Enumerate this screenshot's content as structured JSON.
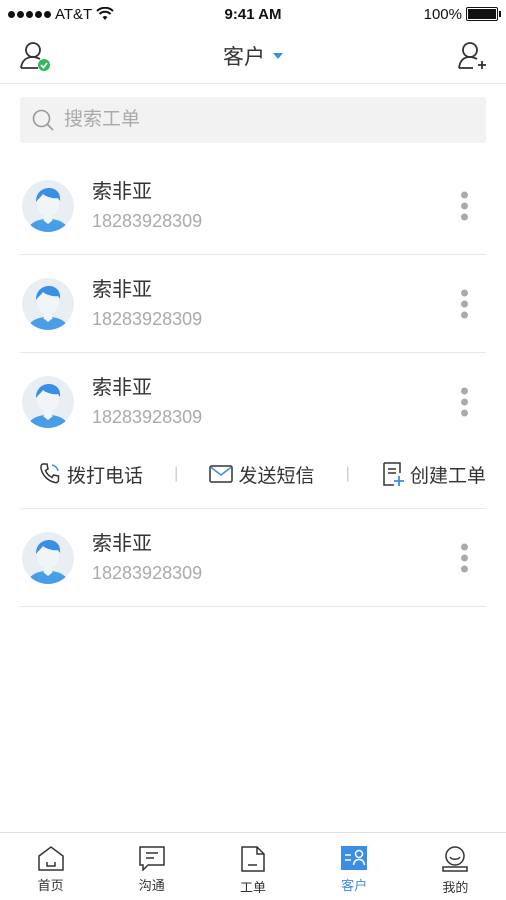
{
  "status_bar": {
    "carrier": "AT&T",
    "time": "9:41 AM",
    "battery": "100%",
    "battery_level": 1.0
  },
  "nav": {
    "title": "客户"
  },
  "search": {
    "placeholder": "搜索工单"
  },
  "customers": [
    {
      "name": "索非亚",
      "phone": "18283928309"
    },
    {
      "name": "索非亚",
      "phone": "18283928309"
    },
    {
      "name": "索非亚",
      "phone": "18283928309"
    },
    {
      "name": "索非亚",
      "phone": "18283928309"
    }
  ],
  "actions": {
    "call": "拨打电话",
    "sms": "发送短信",
    "create_ticket": "创建工单",
    "separator": "|"
  },
  "tabs": [
    {
      "label": "首页",
      "icon": "home-icon"
    },
    {
      "label": "沟通",
      "icon": "chat-icon"
    },
    {
      "label": "工单",
      "icon": "document-icon"
    },
    {
      "label": "客户",
      "icon": "customer-card-icon",
      "active": true
    },
    {
      "label": "我的",
      "icon": "profile-icon"
    }
  ],
  "colors": {
    "accent": "#3a8ee6",
    "success": "#2dbb5d",
    "muted": "#aaaaaa"
  }
}
